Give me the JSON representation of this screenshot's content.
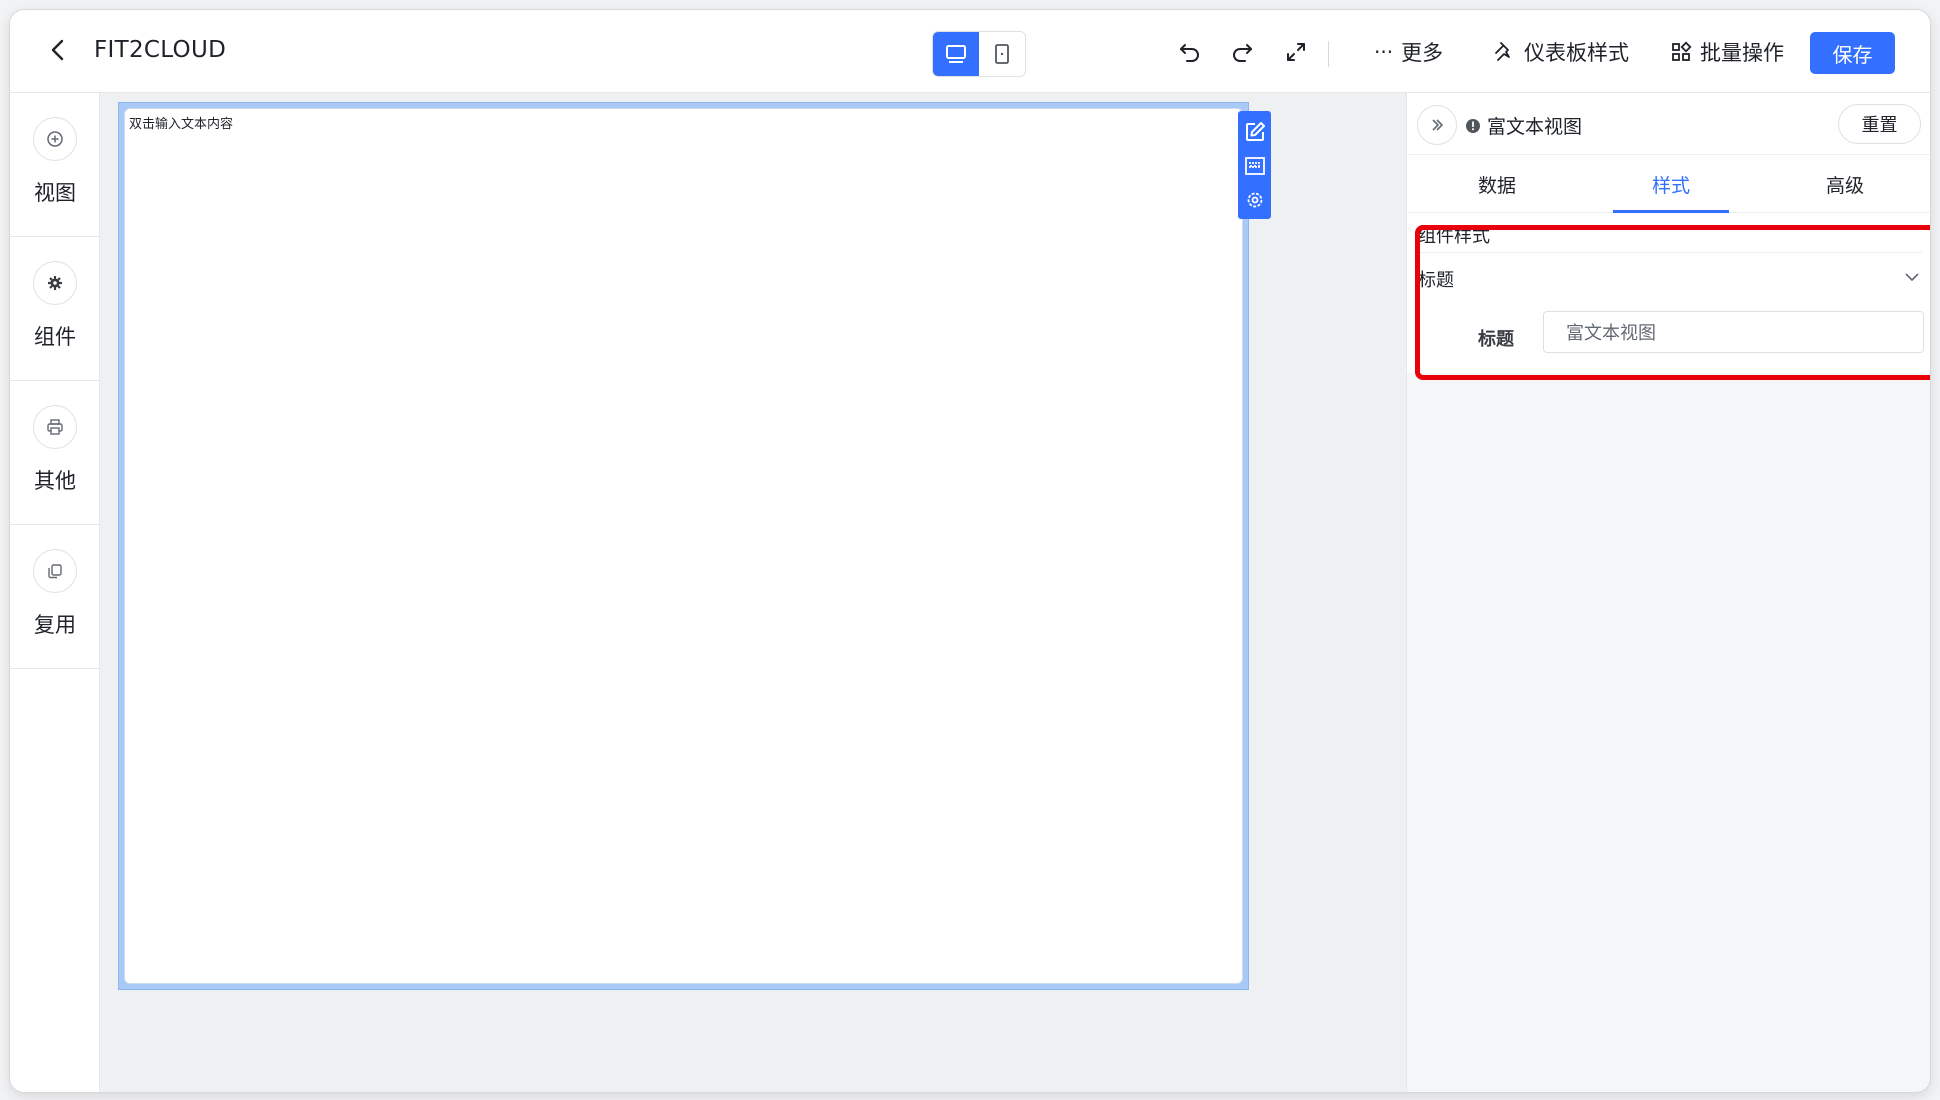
{
  "header": {
    "title": "FIT2CLOUD",
    "more_label": "更多",
    "dashboard_style_label": "仪表板样式",
    "batch_label": "批量操作",
    "save_label": "保存"
  },
  "sidebar": {
    "items": [
      {
        "label": "视图",
        "icon": "plus-circle-icon"
      },
      {
        "label": "组件",
        "icon": "gear-icon"
      },
      {
        "label": "其他",
        "icon": "printer-icon"
      },
      {
        "label": "复用",
        "icon": "copy-icon"
      }
    ]
  },
  "canvas": {
    "placeholder_text": "双击输入文本内容"
  },
  "panel": {
    "title": "富文本视图",
    "reset_label": "重置",
    "tabs": [
      {
        "label": "数据"
      },
      {
        "label": "样式",
        "active": true
      },
      {
        "label": "高级"
      }
    ],
    "section_title": "组件样式",
    "collapse_label": "标题",
    "title_field_label": "标题",
    "title_field_value": "富文本视图"
  },
  "colors": {
    "primary": "#3370ff",
    "highlight": "#e8000b"
  }
}
